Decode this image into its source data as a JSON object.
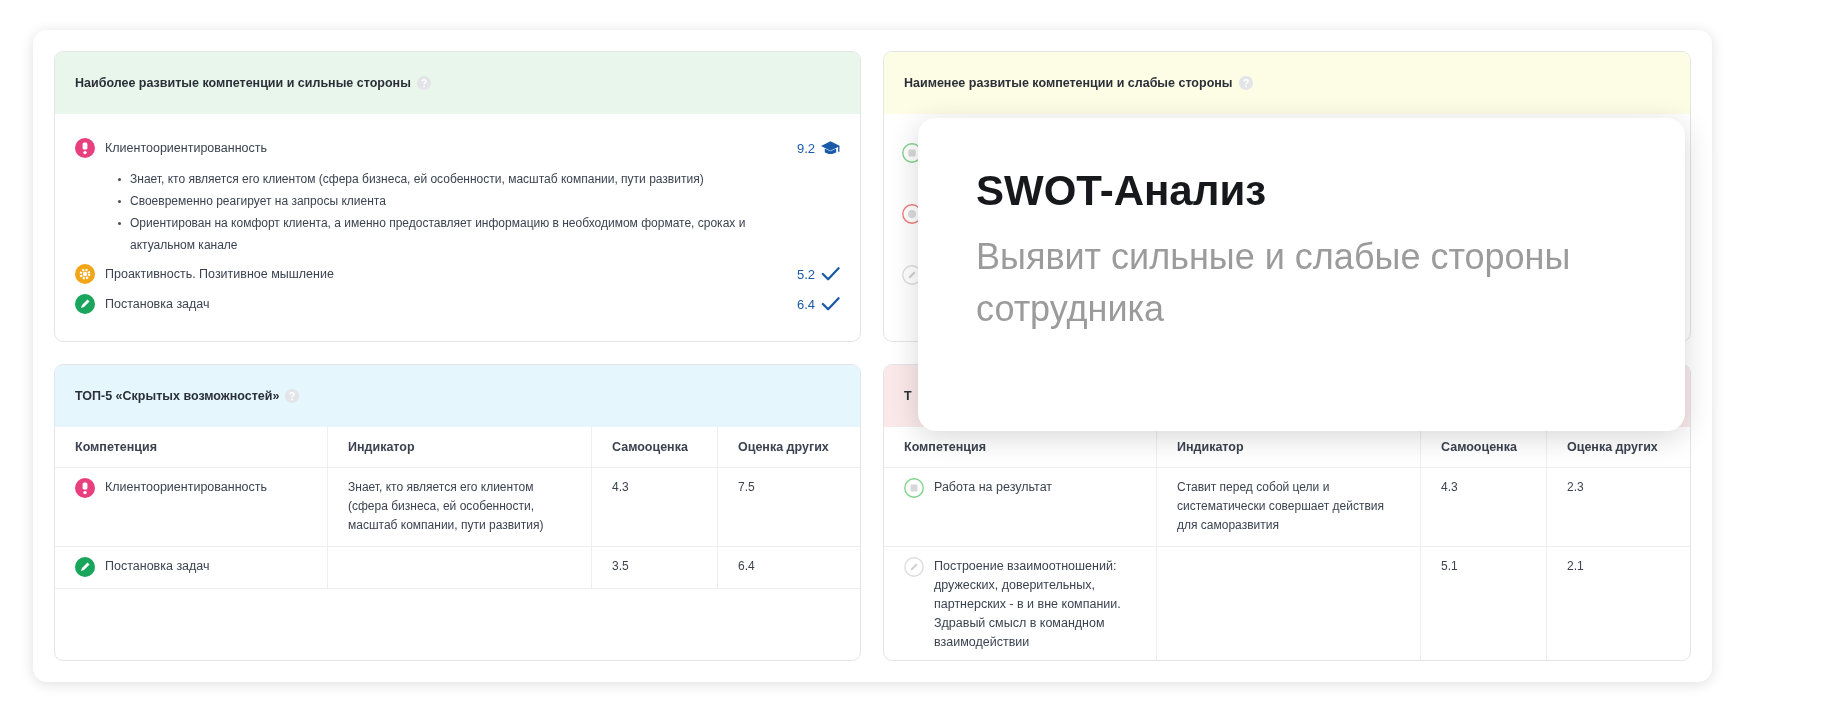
{
  "strengths": {
    "title": "Наиболее развитые компетенции и сильные стороны",
    "help_icon": true,
    "items": [
      {
        "kind": "client",
        "name": "Клиентоориентированность",
        "score": "9.2",
        "score_icon": {
          "kind": "award"
        },
        "indicators": [
          "Знает, кто является его клиентом (сфера бизнеса, ей особенности, масштаб компании, пути развития)",
          "Своевременно реагирует на запросы клиента",
          "Ориентирован на комфорт клиента, а именно предоставляет информацию в необходимом формате, сроках и актуальном канале"
        ]
      },
      {
        "kind": "proactive",
        "name": "Проактивность. Позитивное мышление",
        "score": "5.2",
        "score_icon": {
          "kind": "check"
        }
      },
      {
        "kind": "tasks",
        "name": "Постановка задач",
        "score": "6.4",
        "score_icon": {
          "kind": "check"
        }
      }
    ]
  },
  "weaknesses": {
    "title": "Наименее развитые компетенции и слабые стороны",
    "help_icon": true,
    "items": [
      {
        "kind": "result"
      },
      {
        "kind": "alert"
      },
      {
        "kind": "relations"
      }
    ]
  },
  "hidden": {
    "title": "ТОП-5 «Скрытых возможностей»",
    "help_icon": true,
    "columns": [
      "Компетенция",
      "Индикатор",
      "Самооценка",
      "Оценка других"
    ],
    "rows": [
      {
        "kind": "client",
        "competence": "Клиентоориентированность",
        "indicator": "Знает, кто является его клиентом (сфера бизнеса, ей особенности, масштаб компании, пути развития)",
        "self_score": "4.3",
        "others_score": "7.5"
      },
      {
        "kind": "tasks",
        "competence": "Постановка задач",
        "self_score": "3.5",
        "others_score": "6.4"
      }
    ]
  },
  "blind": {
    "title": "Т",
    "columns": [
      "Компетенция",
      "Индикатор",
      "Самооценка",
      "Оценка других"
    ],
    "rows": [
      {
        "kind": "result",
        "competence": "Работа на результат",
        "indicator": "Ставит перед собой цели и систематически совершает действия для саморазвития",
        "self_score": "4.3",
        "others_score": "2.3"
      },
      {
        "kind": "relations",
        "competence": "Построение взаимоотношений: дружеских, доверительных, партнерских - в и вне компании. Здравый смысл в командном взаимодействии",
        "self_score": "5.1",
        "others_score": "2.1"
      }
    ]
  },
  "popup": {
    "title": "SWOT-Анализ",
    "subtitle": "Выявит сильные и слабые стороны сотрудника"
  }
}
